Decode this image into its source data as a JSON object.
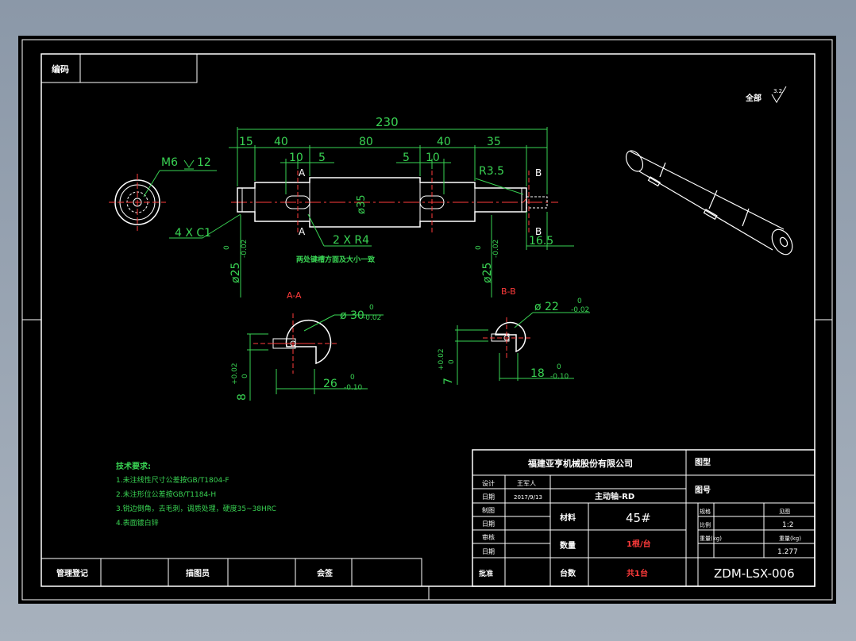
{
  "colors": {
    "background": "#000000",
    "outline": "#ffffff",
    "dimension": "#39d353",
    "centerline": "#ff3b3b"
  },
  "header": {
    "code_label": "编码",
    "roughness_label": "全部",
    "roughness_value": "3.2"
  },
  "main_view": {
    "overall_length": "230",
    "seg_15": "15",
    "seg_40a": "40",
    "seg_80": "80",
    "seg_40b": "40",
    "seg_35": "35",
    "key_10a": "10",
    "key_5a": "5",
    "key_5b": "5",
    "key_10b": "10",
    "thread": "M6",
    "thread_depth": "12",
    "radius": "R3.5",
    "dia_35": "ø35",
    "chamfer": "4 X C1",
    "fillet": "2 X R4",
    "len_16_5": "16.5",
    "dia_25_left": "ø25",
    "dia_25_right": "ø25",
    "tol_zero": "0",
    "tol_neg002": "-0.02",
    "note": "两处键槽方面及大小一致",
    "sec_a": "A",
    "sec_b": "B"
  },
  "section_aa": {
    "title": "A-A",
    "dia": "ø 30",
    "dia_up": "0",
    "dia_low": "-0.02",
    "width": "26",
    "width_up": "0",
    "width_low": "-0.10",
    "key": "8",
    "key_up": "+0.02",
    "key_low": "0"
  },
  "section_bb": {
    "title": "B-B",
    "dia": "ø 22",
    "dia_up": "0",
    "dia_low": "-0.02",
    "width": "18",
    "width_up": "0",
    "width_low": "-0.10",
    "key": "7",
    "key_up": "+0.02",
    "key_low": "0"
  },
  "technical": {
    "heading": "技术要求:",
    "items": [
      "1.未注线性尺寸公差按GB/T1804-F",
      "2.未注形位公差按GB/T1184-H",
      "3.锐边倒角，去毛刺，调质处理，硬度35~38HRC",
      "4.表面镀白锌"
    ]
  },
  "left_strip": {
    "c1": "管理登记",
    "c2": "描图员",
    "c3": "会签"
  },
  "title_block": {
    "company": "福建亚亨机械股份有限公司",
    "drawing_label": "图型",
    "material_fig_label": "图号",
    "part_name": "主动轴-RD",
    "row_labels": [
      "设计",
      "日期",
      "制图",
      "日期",
      "审核",
      "日期",
      "批准"
    ],
    "designer": "王军人",
    "date": "2017/9/13",
    "material_label": "材料",
    "material": "45#",
    "qty_label": "数量",
    "qty": "1根/台",
    "units_label": "台数",
    "units": "共1台",
    "ratio_label": "比例",
    "ratio": "1:2",
    "scale_label": "比例",
    "weight_label": "重量(kg)",
    "weight": "1.277",
    "size_label": "规格",
    "size_value": "见图",
    "part_no": "ZDM-LSX-006"
  }
}
